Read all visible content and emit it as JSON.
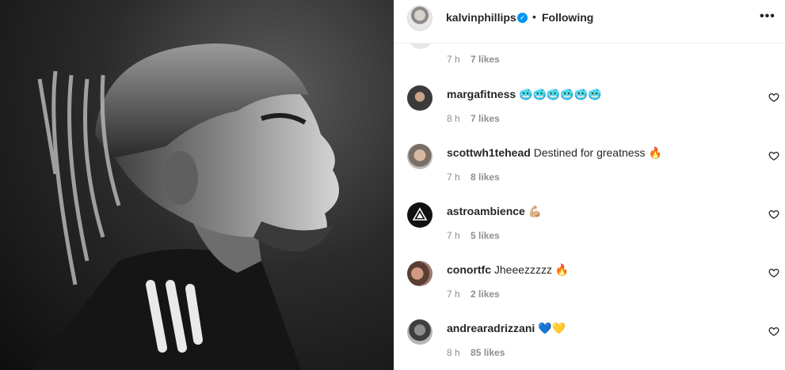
{
  "post": {
    "author": "kalvinphillips",
    "follow_status": "Following",
    "separator": "•",
    "more_icon": "more-horizontal-icon"
  },
  "first_comment_meta": {
    "time": "7 h",
    "likes": "7 likes"
  },
  "comments": [
    {
      "user": "margafitness",
      "text": "🥶🥶🥶🥶🥶🥶",
      "time": "8 h",
      "likes": "7 likes"
    },
    {
      "user": "scottwh1tehead",
      "text": "Destined for greatness 🔥",
      "time": "7 h",
      "likes": "8 likes"
    },
    {
      "user": "astroambience",
      "text": "💪🏼",
      "time": "7 h",
      "likes": "5 likes"
    },
    {
      "user": "conortfc",
      "text": "Jheeezzzzz 🔥",
      "time": "7 h",
      "likes": "2 likes"
    },
    {
      "user": "andrearadrizzani",
      "text": "💙💛",
      "time": "8 h",
      "likes": "85 likes"
    }
  ],
  "colors": {
    "verified_blue": "#0095f6",
    "text_primary": "#262626",
    "text_secondary": "#8e8e8e",
    "divider": "#efefef"
  }
}
